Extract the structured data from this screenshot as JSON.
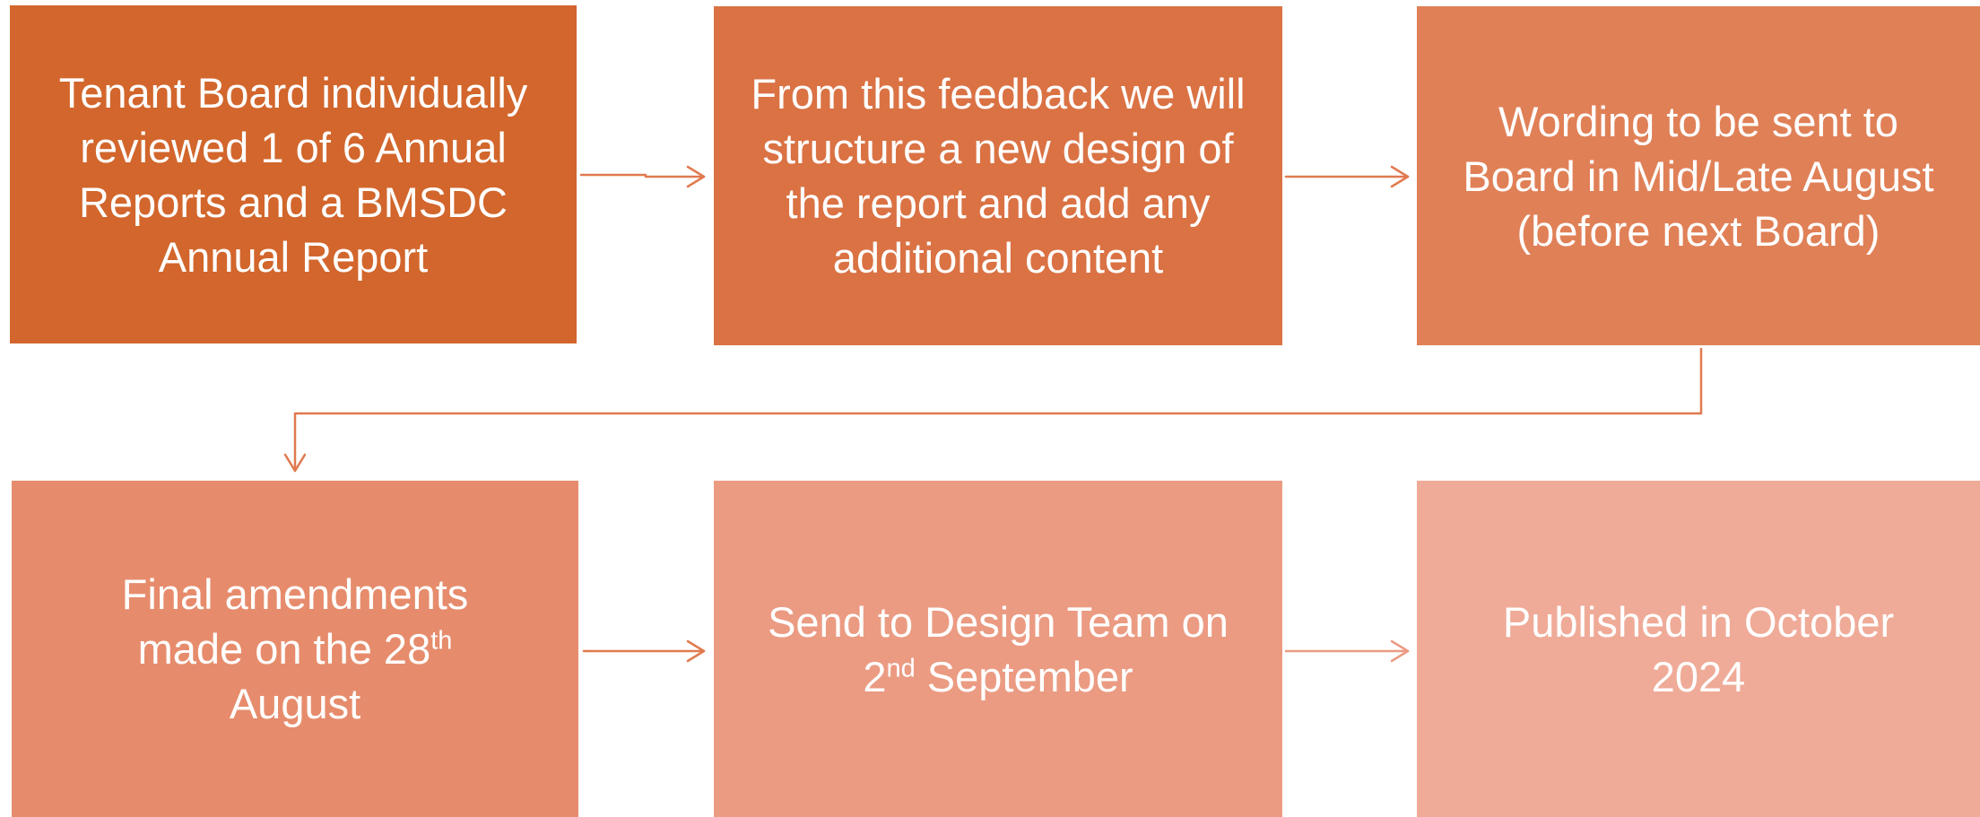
{
  "steps": [
    {
      "text": "Tenant Board individually reviewed 1 of 6 Annual Reports and a BMSDC Annual Report",
      "color": "#d2662c"
    },
    {
      "text": "From this feedback we will structure a new design of the report and add any additional content",
      "color": "#da7244"
    },
    {
      "text": "Wording to be sent to Board in Mid/Late August (before next Board)",
      "color": "#e08057"
    },
    {
      "before": "Final amendments made on the 28",
      "sup": "th",
      "after": "August",
      "color": "#e68c6c"
    },
    {
      "before": "Send to Design Team on 2",
      "sup": "nd",
      "after": "September",
      "color": "#eb9b82"
    },
    {
      "text": "Published in October 2024",
      "color": "#efab98"
    }
  ],
  "arrow_color": "#e07a4f"
}
